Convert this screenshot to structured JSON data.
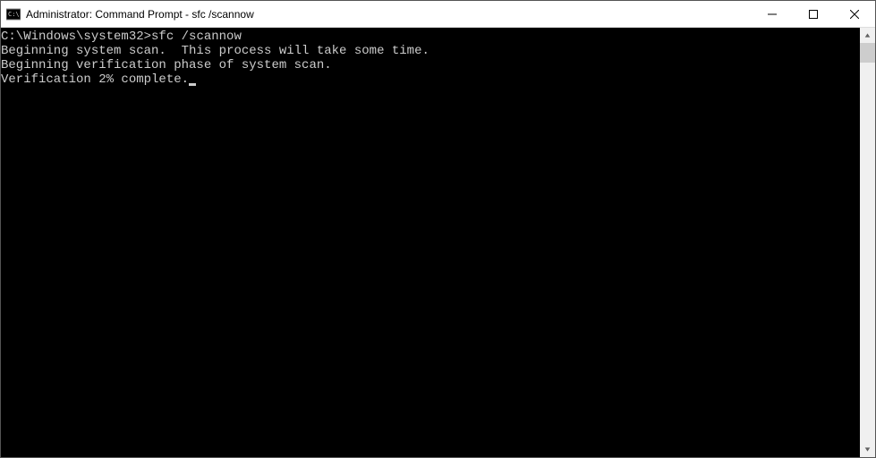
{
  "window": {
    "title": "Administrator: Command Prompt - sfc  /scannow"
  },
  "terminal": {
    "blank0": "",
    "line1_prompt": "C:\\Windows\\system32>",
    "line1_cmd": "sfc /scannow",
    "blank1": "",
    "line2": "Beginning system scan.  This process will take some time.",
    "blank2": "",
    "line3": "Beginning verification phase of system scan.",
    "line4": "Verification 2% complete."
  }
}
